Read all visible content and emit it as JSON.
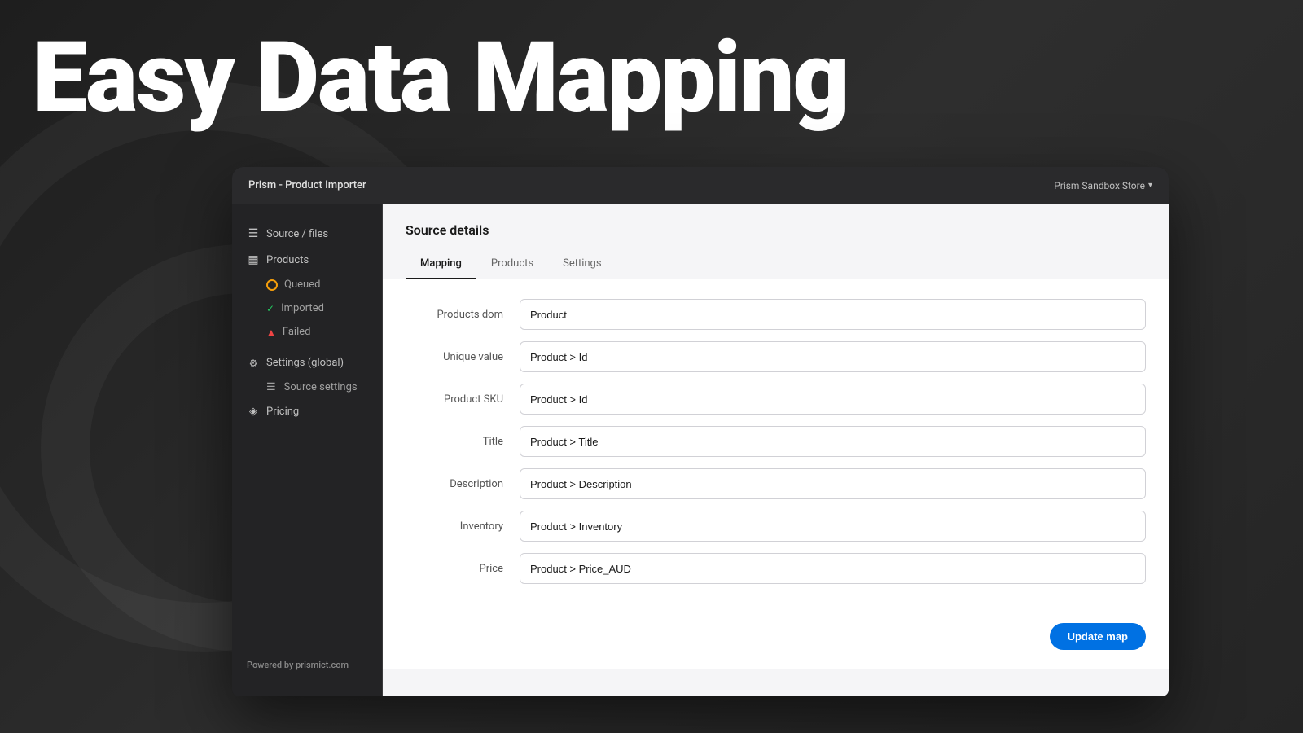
{
  "background": {
    "headline": "Easy Data Mapping"
  },
  "titleBar": {
    "appTitle": "Prism - Product Importer",
    "storeName": "Prism Sandbox Store",
    "storeChevron": "▾"
  },
  "sidebar": {
    "items": [
      {
        "id": "source-files",
        "label": "Source / files",
        "icon": "☰",
        "active": false
      },
      {
        "id": "products",
        "label": "Products",
        "icon": "▦",
        "active": false
      }
    ],
    "subItems": [
      {
        "id": "queued",
        "label": "Queued",
        "dotType": "orange"
      },
      {
        "id": "imported",
        "label": "Imported",
        "dotType": "green"
      },
      {
        "id": "failed",
        "label": "Failed",
        "dotType": "red"
      }
    ],
    "settingsItems": [
      {
        "id": "settings-global",
        "label": "Settings (global)",
        "icon": "⚙"
      },
      {
        "id": "source-settings",
        "label": "Source settings",
        "icon": "☰"
      },
      {
        "id": "pricing",
        "label": "Pricing",
        "icon": "◈"
      }
    ],
    "footer": {
      "poweredBy": "Powered by ",
      "link": "prismict.com"
    }
  },
  "mainContent": {
    "title": "Source details",
    "tabs": [
      {
        "id": "mapping",
        "label": "Mapping",
        "active": true
      },
      {
        "id": "products",
        "label": "Products",
        "active": false
      },
      {
        "id": "settings",
        "label": "Settings",
        "active": false
      }
    ],
    "formFields": [
      {
        "id": "products-dom",
        "label": "Products dom",
        "value": "Product"
      },
      {
        "id": "unique-value",
        "label": "Unique value",
        "value": "Product > Id"
      },
      {
        "id": "product-sku",
        "label": "Product SKU",
        "value": "Product > Id"
      },
      {
        "id": "title",
        "label": "Title",
        "value": "Product > Title"
      },
      {
        "id": "description",
        "label": "Description",
        "value": "Product > Description"
      },
      {
        "id": "inventory",
        "label": "Inventory",
        "value": "Product > Inventory"
      },
      {
        "id": "price",
        "label": "Price",
        "value": "Product > Price_AUD"
      }
    ],
    "updateButton": "Update map"
  }
}
